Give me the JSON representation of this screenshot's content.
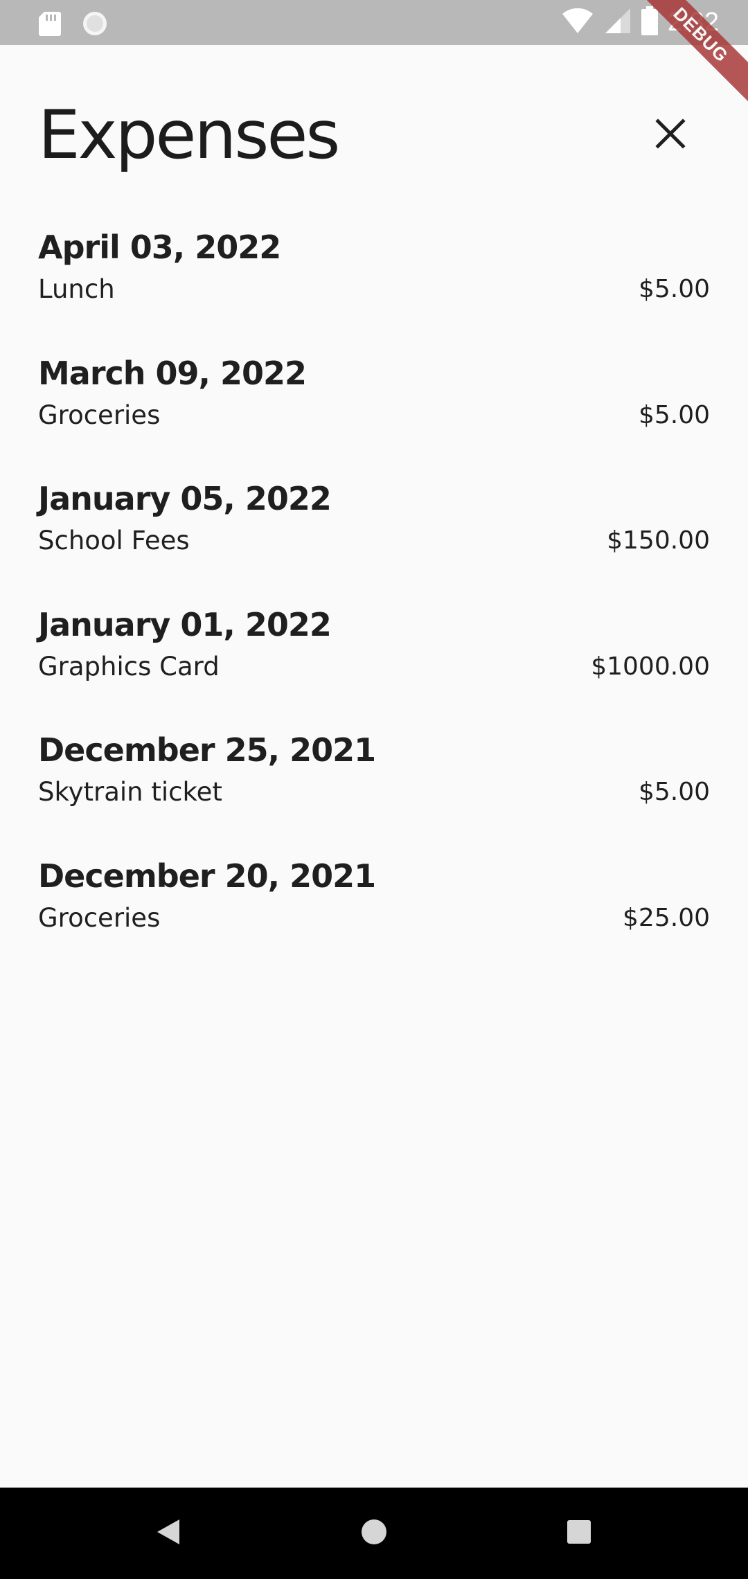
{
  "status_bar": {
    "time": "2:32",
    "icons": [
      "sd-card-icon",
      "sync-icon",
      "wifi-icon",
      "signal-icon",
      "battery-icon"
    ]
  },
  "debug_banner": "DEBUG",
  "header": {
    "title": "Expenses",
    "close_icon": "close-icon"
  },
  "expenses": [
    {
      "date": "April 03, 2022",
      "description": "Lunch",
      "amount": "$5.00"
    },
    {
      "date": "March 09, 2022",
      "description": "Groceries",
      "amount": "$5.00"
    },
    {
      "date": "January 05, 2022",
      "description": "School Fees",
      "amount": "$150.00"
    },
    {
      "date": "January 01, 2022",
      "description": "Graphics Card",
      "amount": "$1000.00"
    },
    {
      "date": "December 25, 2021",
      "description": "Skytrain ticket",
      "amount": "$5.00"
    },
    {
      "date": "December 20, 2021",
      "description": "Groceries",
      "amount": "$25.00"
    }
  ],
  "nav_bar": {
    "back_icon": "back-icon",
    "home_icon": "home-icon",
    "recents_icon": "recents-icon"
  },
  "colors": {
    "background": "#fafafa",
    "status_bar": "#b8b8b8",
    "text": "#1f1f1f",
    "debug_ribbon": "#a83a3a",
    "nav_bar": "#000000"
  }
}
